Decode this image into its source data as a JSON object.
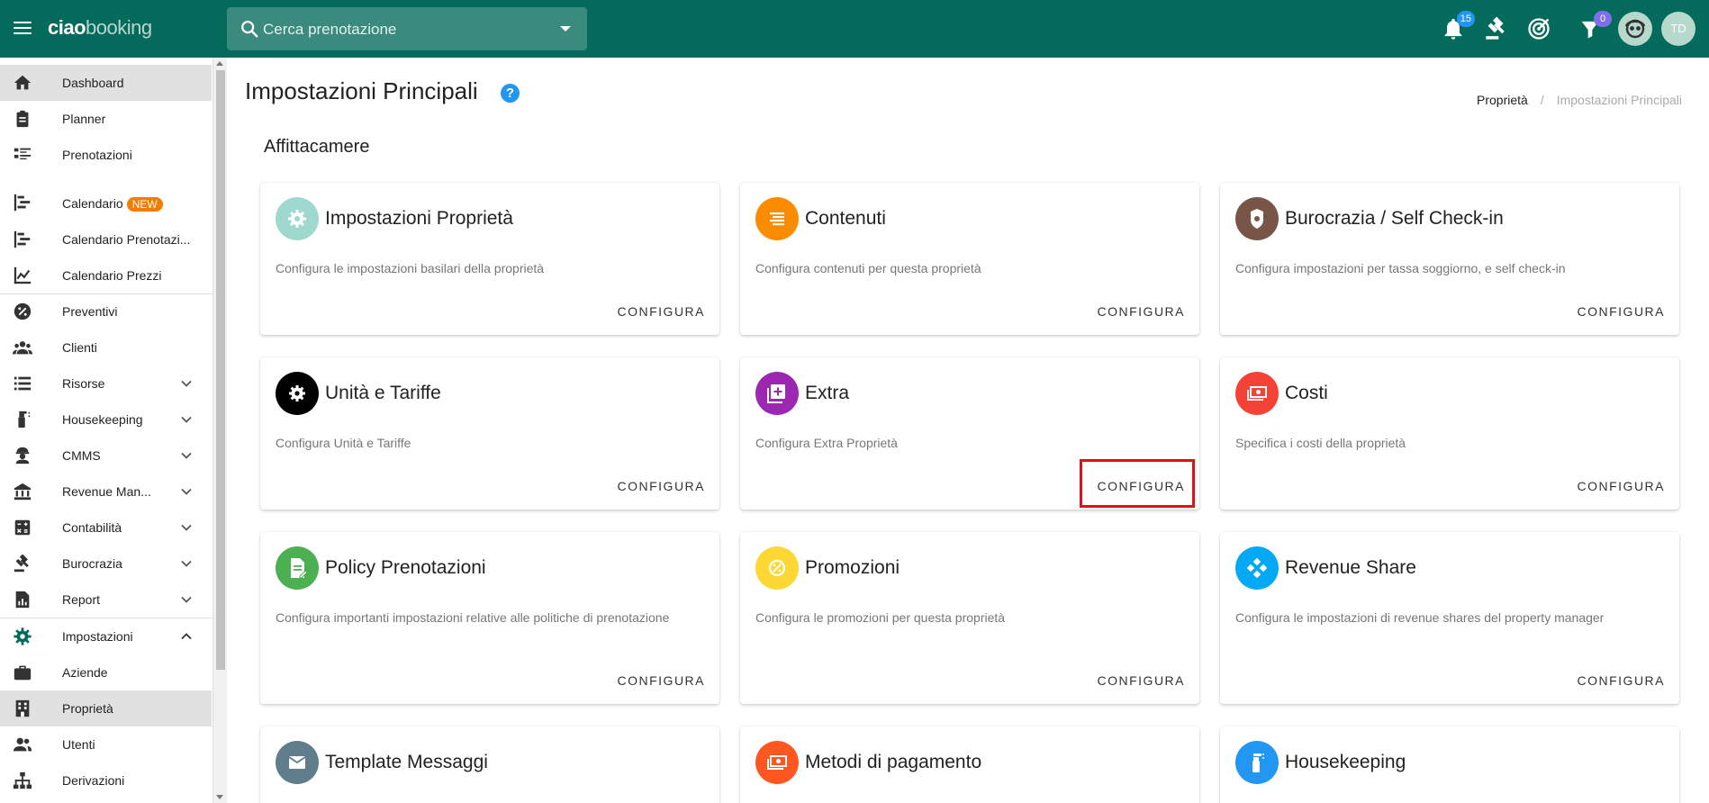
{
  "header": {
    "logo_bold": "ciao",
    "logo_light": "booking",
    "search_placeholder": "Cerca prenotazione",
    "notifications_count": "15",
    "filter_count": "0",
    "avatar_initials": "TD",
    "brand_color": "#046a5b"
  },
  "sidebar": {
    "items": [
      {
        "label": "Dashboard",
        "icon": "home-icon"
      },
      {
        "label": "Planner",
        "icon": "clipboard-icon"
      },
      {
        "label": "Prenotazioni",
        "icon": "list-icon"
      },
      {
        "label": "Calendario",
        "badge": "NEW",
        "icon": "gantt-icon"
      },
      {
        "label": "Calendario Prenotazi...",
        "icon": "gantt-icon"
      },
      {
        "label": "Calendario Prezzi",
        "icon": "chart-icon"
      },
      {
        "label": "Preventivi",
        "icon": "discount-icon"
      },
      {
        "label": "Clienti",
        "icon": "people-icon"
      },
      {
        "label": "Risorse",
        "icon": "list-icon"
      },
      {
        "label": "Housekeeping",
        "icon": "spray-icon"
      },
      {
        "label": "CMMS",
        "icon": "worker-icon"
      },
      {
        "label": "Revenue Man...",
        "icon": "bank-icon"
      },
      {
        "label": "Contabilità",
        "icon": "calculator-icon"
      },
      {
        "label": "Burocrazia",
        "icon": "gavel-icon"
      },
      {
        "label": "Report",
        "icon": "report-icon"
      },
      {
        "label": "Impostazioni",
        "icon": "gear-icon"
      },
      {
        "label": "Aziende",
        "icon": "briefcase-icon"
      },
      {
        "label": "Proprietà",
        "icon": "building-icon"
      },
      {
        "label": "Utenti",
        "icon": "people-icon"
      },
      {
        "label": "Derivazioni",
        "icon": "sitemap-icon"
      }
    ]
  },
  "main": {
    "title": "Impostazioni Principali",
    "help": "?",
    "breadcrumb": [
      "Proprietà",
      "/",
      "Impostazioni Principali"
    ],
    "section": "Affittacamere",
    "action_label": "CONFIGURA",
    "cards": [
      {
        "title": "Impostazioni Proprietà",
        "desc": "Configura le impostazioni basilari della proprietà",
        "color": "#9fd8cf"
      },
      {
        "title": "Contenuti",
        "desc": "Configura contenuti per questa proprietà",
        "color": "#fb8c00"
      },
      {
        "title": "Burocrazia / Self Check-in",
        "desc": "Configura impostazioni per tassa soggiorno, e self check-in",
        "color": "#795548"
      },
      {
        "title": "Unità e Tariffe",
        "desc": "Configura Unità e Tariffe",
        "color": "#000000"
      },
      {
        "title": "Extra",
        "desc": "Configura Extra Proprietà",
        "color": "#9c27b0"
      },
      {
        "title": "Costi",
        "desc": "Specifica i costi della proprietà",
        "color": "#f44336"
      },
      {
        "title": "Policy Prenotazioni",
        "desc": "Configura importanti impostazioni relative alle politiche di prenotazione",
        "color": "#4caf50"
      },
      {
        "title": "Promozioni",
        "desc": "Configura le promozioni per questa proprietà",
        "color": "#fdd835"
      },
      {
        "title": "Revenue Share",
        "desc": "Configura le impostazioni di revenue shares del property manager",
        "color": "#03a9f4"
      },
      {
        "title": "Template Messaggi",
        "desc": "",
        "color": "#607d8b"
      },
      {
        "title": "Metodi di pagamento",
        "desc": "",
        "color": "#ff5722"
      },
      {
        "title": "Housekeeping",
        "desc": "",
        "color": "#2196f3"
      }
    ],
    "highlight_color": "#e0101b"
  }
}
